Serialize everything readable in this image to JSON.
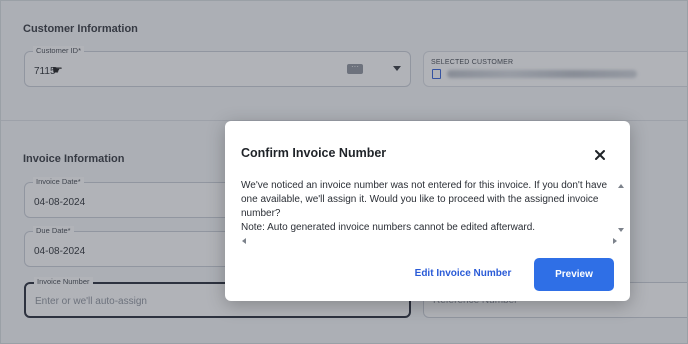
{
  "customer_section": {
    "title": "Customer Information",
    "customer_id": {
      "label": "Customer ID*",
      "value": "7115"
    },
    "selected_customer": {
      "label": "SELECTED CUSTOMER"
    }
  },
  "invoice_section": {
    "title": "Invoice Information",
    "invoice_date": {
      "label": "Invoice Date*",
      "value": "04-08-2024"
    },
    "due_date": {
      "label": "Due Date*",
      "value": "04-08-2024"
    },
    "invoice_number": {
      "label": "Invoice Number",
      "placeholder": "Enter or we'll auto-assign"
    },
    "reference_number": {
      "placeholder": "Reference Number"
    }
  },
  "dialog": {
    "title": "Confirm Invoice Number",
    "message": "We've noticed an invoice number was not entered for this invoice. If you don't have one available, we'll assign it. Would you like to proceed with the assigned invoice number?",
    "note": "Note: Auto generated invoice numbers cannot be edited afterward.",
    "edit_button": "Edit Invoice Number",
    "preview_button": "Preview"
  },
  "colors": {
    "accent": "#2f6fe6",
    "link": "#2a5bd7",
    "overlay": "rgba(70,75,85,0.42)"
  }
}
